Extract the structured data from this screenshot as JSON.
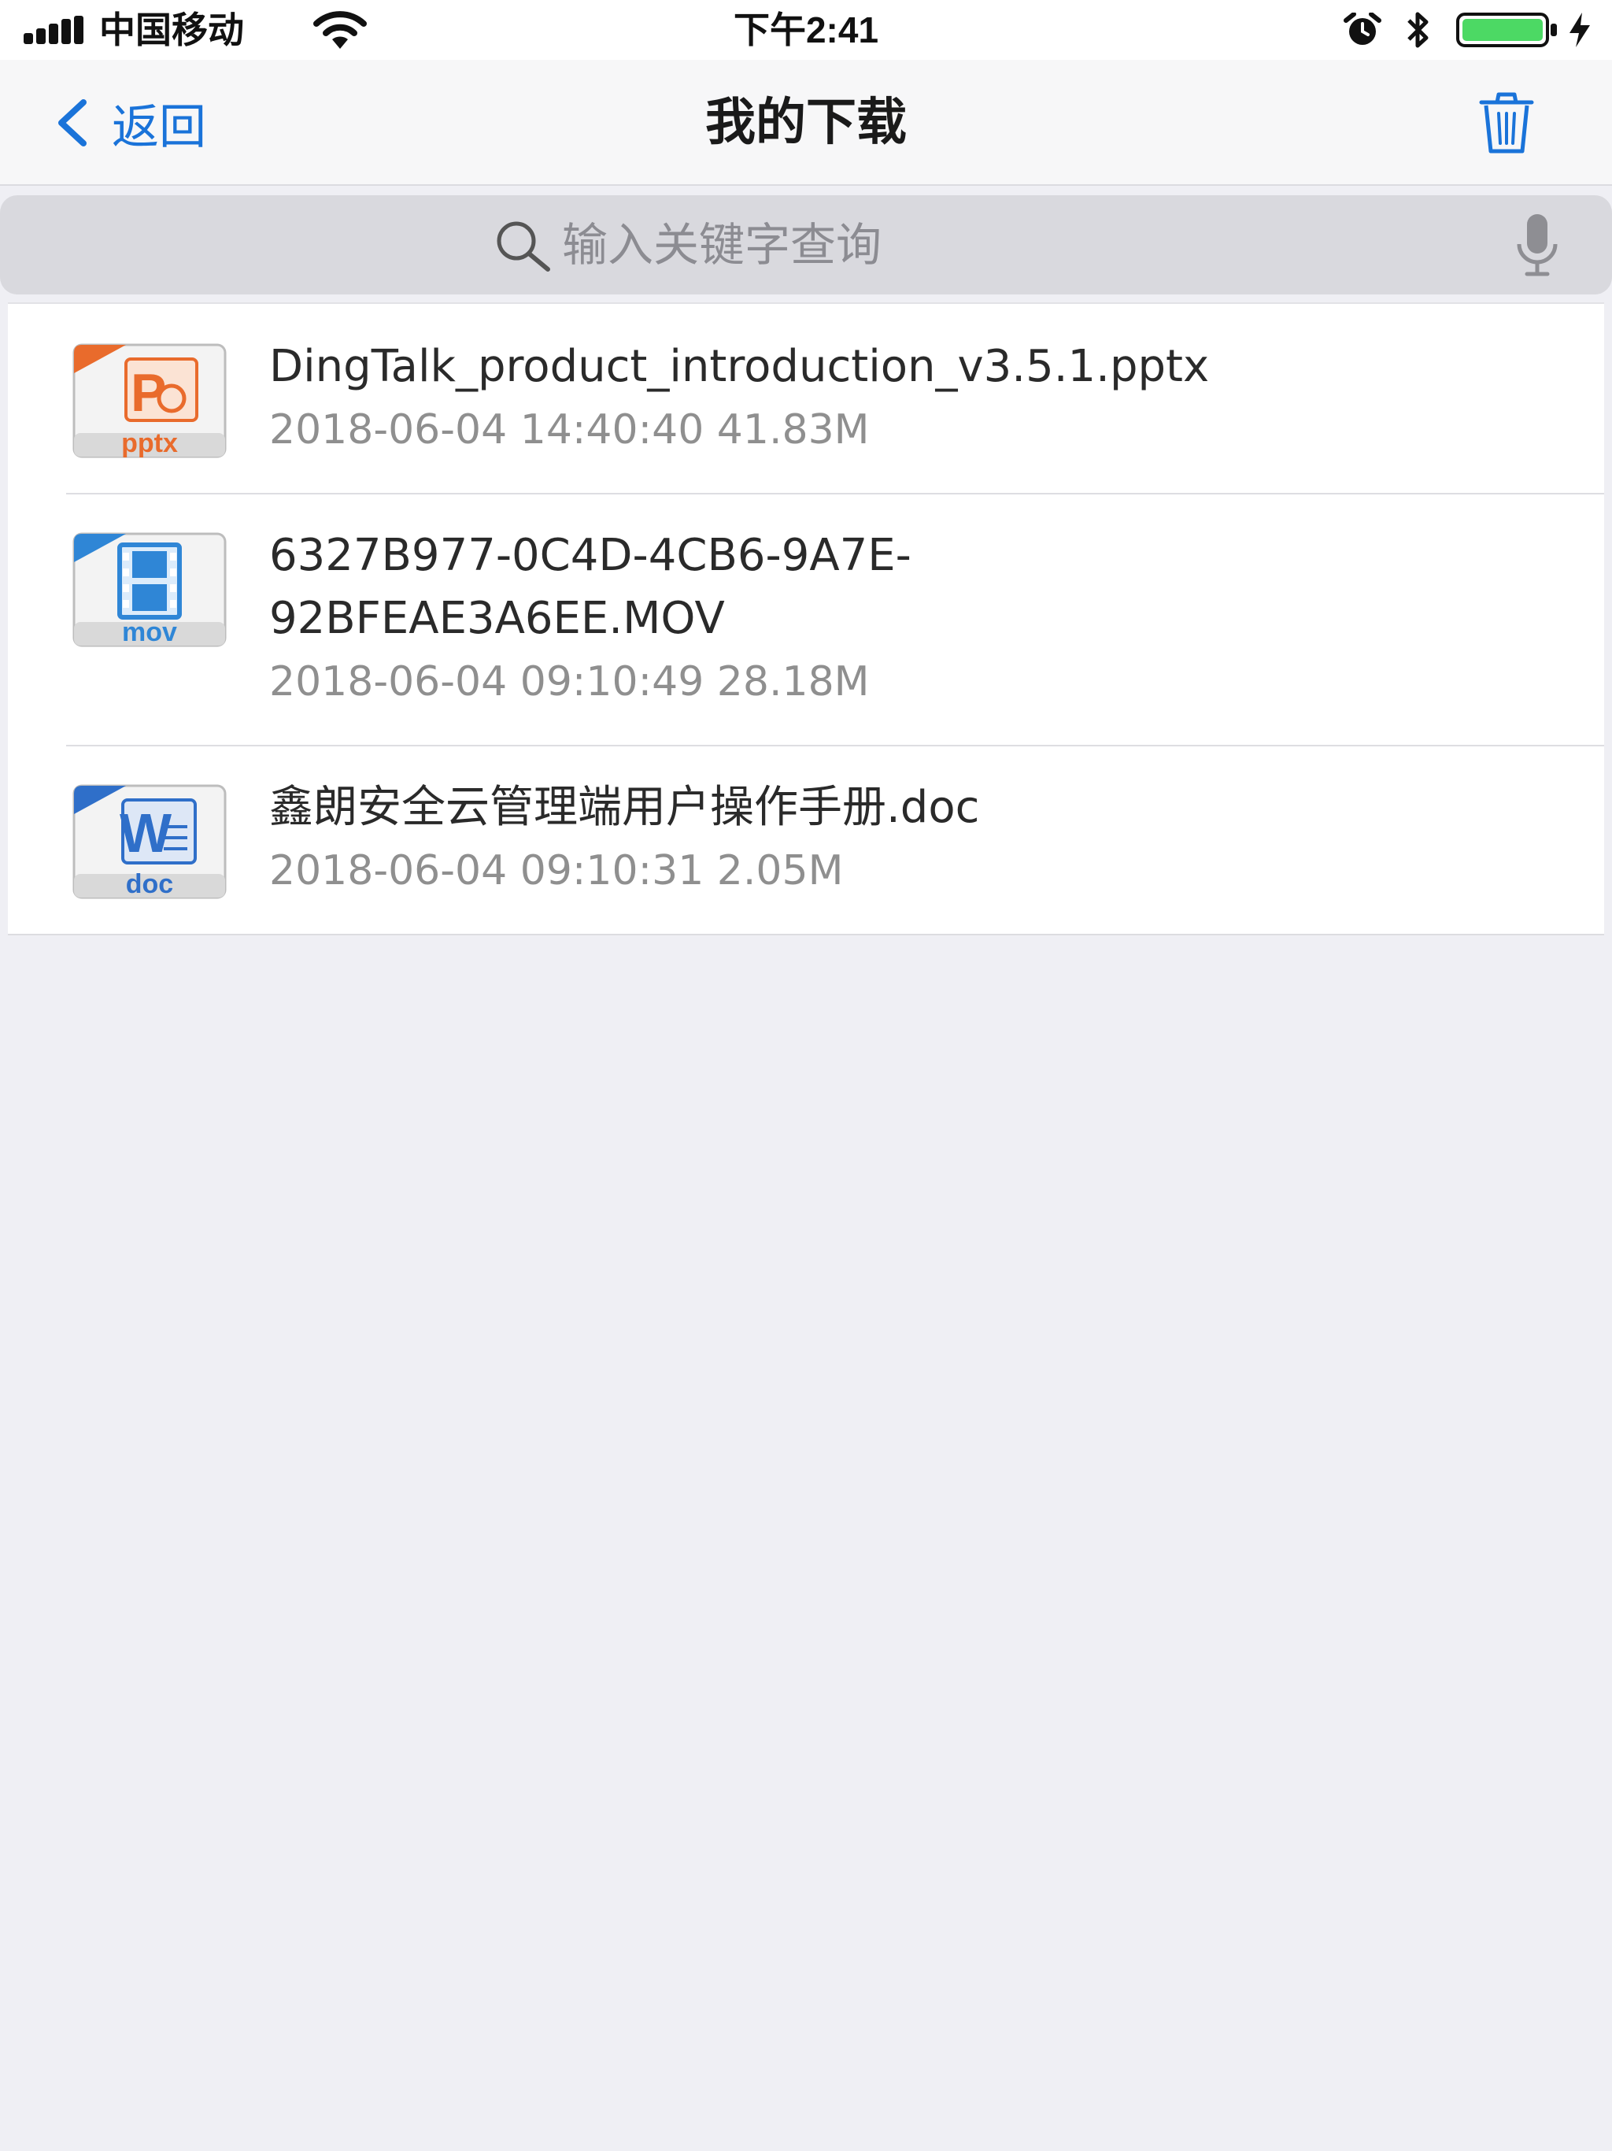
{
  "status_bar": {
    "carrier": "中国移动",
    "time": "下午2:41",
    "battery_level_percent": 100,
    "icons": [
      "signal-icon",
      "wifi-icon",
      "alarm-icon",
      "bluetooth-icon",
      "battery-icon",
      "charging-icon"
    ]
  },
  "nav": {
    "back_label": "返回",
    "title": "我的下载",
    "trash_icon": "trash-icon"
  },
  "search": {
    "placeholder": "输入关键字查询",
    "value": "",
    "icon": "search-icon",
    "mic_icon": "microphone-icon"
  },
  "colors": {
    "accent": "#1a73d9",
    "background": "#efeff4",
    "pptx": "#e96b2c",
    "mov": "#2f86d6",
    "doc": "#2f6fc9",
    "battery": "#4cd964"
  },
  "files": [
    {
      "name_lines": [
        "DingTalk_product_introduction_v3.5.1.pptx"
      ],
      "meta": "2018-06-04 14:40:40 41.83M",
      "type": "pptx",
      "icon_letter": "P",
      "icon_ext": "pptx"
    },
    {
      "name_lines": [
        "6327B977-0C4D-4CB6-9A7E-",
        "92BFEAE3A6EE.MOV"
      ],
      "meta": "2018-06-04 09:10:49 28.18M",
      "type": "mov",
      "icon_letter": "",
      "icon_ext": "mov"
    },
    {
      "name_lines": [
        "鑫朗安全云管理端用户操作手册.doc"
      ],
      "meta": "2018-06-04 09:10:31 2.05M",
      "type": "doc",
      "icon_letter": "W",
      "icon_ext": "doc"
    }
  ]
}
